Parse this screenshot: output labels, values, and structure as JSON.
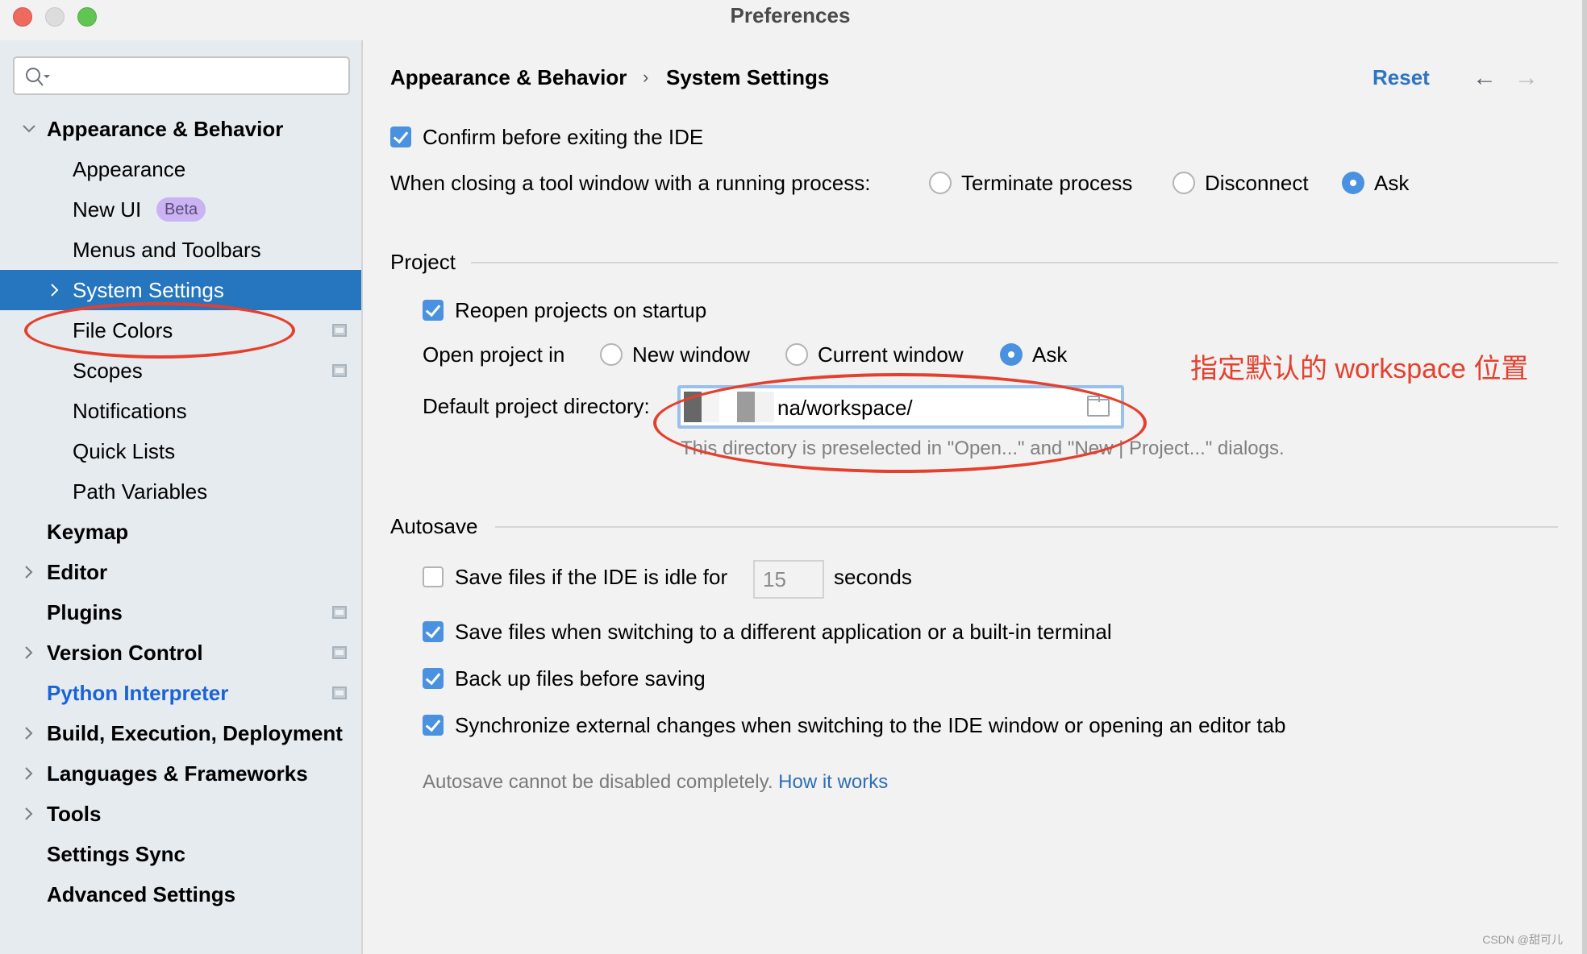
{
  "window": {
    "title": "Preferences"
  },
  "search": {
    "placeholder": "",
    "value": ""
  },
  "sidebar": {
    "items": [
      {
        "label": "Appearance & Behavior",
        "level": 1,
        "bold": true,
        "expander": "expanded"
      },
      {
        "label": "Appearance",
        "level": 2
      },
      {
        "label": "New UI",
        "level": 2,
        "badge": "Beta"
      },
      {
        "label": "Menus and Toolbars",
        "level": 2
      },
      {
        "label": "System Settings",
        "level": 2,
        "selected": true,
        "expander": "collapsed"
      },
      {
        "label": "File Colors",
        "level": 2,
        "project_icon": true
      },
      {
        "label": "Scopes",
        "level": 2,
        "project_icon": true
      },
      {
        "label": "Notifications",
        "level": 2
      },
      {
        "label": "Quick Lists",
        "level": 2
      },
      {
        "label": "Path Variables",
        "level": 2
      },
      {
        "label": "Keymap",
        "level": 1,
        "bold": true
      },
      {
        "label": "Editor",
        "level": 1,
        "bold": true,
        "expander": "collapsed"
      },
      {
        "label": "Plugins",
        "level": 1,
        "bold": true,
        "project_icon": true
      },
      {
        "label": "Version Control",
        "level": 1,
        "bold": true,
        "expander": "collapsed",
        "project_icon": true
      },
      {
        "label": "Python Interpreter",
        "level": 1,
        "bold": true,
        "link": true,
        "project_icon": true
      },
      {
        "label": "Build, Execution, Deployment",
        "level": 1,
        "bold": true,
        "expander": "collapsed"
      },
      {
        "label": "Languages & Frameworks",
        "level": 1,
        "bold": true,
        "expander": "collapsed"
      },
      {
        "label": "Tools",
        "level": 1,
        "bold": true,
        "expander": "collapsed"
      },
      {
        "label": "Settings Sync",
        "level": 1,
        "bold": true
      },
      {
        "label": "Advanced Settings",
        "level": 1,
        "bold": true
      }
    ]
  },
  "header": {
    "breadcrumb": [
      "Appearance & Behavior",
      "System Settings"
    ],
    "breadcrumb_separator": "›",
    "reset_label": "Reset",
    "back_icon": "←",
    "forward_icon": "→"
  },
  "general": {
    "confirm_exit": {
      "label": "Confirm before exiting the IDE",
      "checked": true
    },
    "closing_tool_window": {
      "label": "When closing a tool window with a running process:",
      "options": [
        "Terminate process",
        "Disconnect",
        "Ask"
      ],
      "selected": "Ask"
    }
  },
  "project": {
    "title": "Project",
    "reopen": {
      "label": "Reopen projects on startup",
      "checked": true
    },
    "open_in": {
      "label": "Open project in",
      "options": [
        "New window",
        "Current window",
        "Ask"
      ],
      "selected": "Ask"
    },
    "default_dir": {
      "label": "Default project directory:",
      "value": "na/workspace/",
      "hint": "This directory is preselected in \"Open...\" and \"New | Project...\" dialogs."
    },
    "annotation": "指定默认的 workspace 位置"
  },
  "autosave": {
    "title": "Autosave",
    "idle": {
      "label_before": "Save files if the IDE is idle for",
      "value": "15",
      "label_after": "seconds",
      "checked": false
    },
    "switching": {
      "label": "Save files when switching to a different application or a built-in terminal",
      "checked": true
    },
    "backup": {
      "label": "Back up files before saving",
      "checked": true
    },
    "sync": {
      "label": "Synchronize external changes when switching to the IDE window or opening an editor tab",
      "checked": true
    },
    "footnote": "Autosave cannot be disabled completely.",
    "footnote_link": "How it works"
  },
  "watermark": "CSDN @甜可儿",
  "colors": {
    "accent": "#2675bf",
    "checkbox": "#4a92e0",
    "annotation": "#e5402e",
    "link": "#2f6eb5"
  }
}
